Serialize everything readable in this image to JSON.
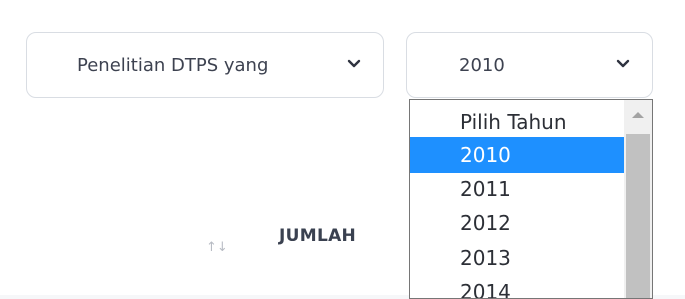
{
  "filters": {
    "category_select": {
      "value": "Penelitian DTPS yang",
      "icon": "chevron-down-icon"
    },
    "year_select": {
      "value": "2010",
      "icon": "chevron-down-icon"
    }
  },
  "year_dropdown": {
    "options": [
      "Pilih Tahun",
      "2010",
      "2011",
      "2012",
      "2013",
      "2014"
    ],
    "selected": "2010",
    "highlight_color": "#1e90ff"
  },
  "table": {
    "sort_icon": "sort-arrows-icon",
    "sort_glyph": "↑↓",
    "column_header": "JUMLAH"
  }
}
